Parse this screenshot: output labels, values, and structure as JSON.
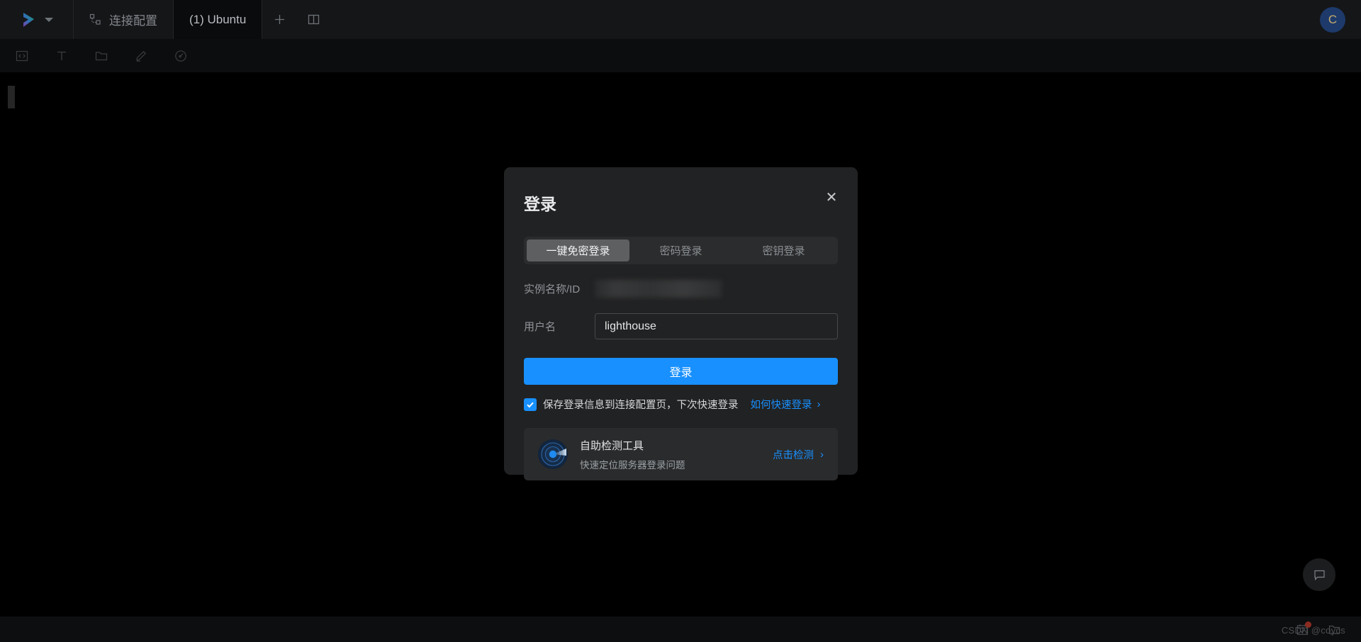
{
  "titlebar": {
    "logo_icon": "app-logo-chevron",
    "dropdown_icon": "chevron-down-icon",
    "tabs": [
      {
        "label": "连接配置",
        "icon": "topology-icon",
        "active": false
      },
      {
        "label": "(1) Ubuntu",
        "icon": "",
        "active": true
      }
    ],
    "new_tab_label": "+",
    "split_label": "split-pane-icon",
    "avatar_initial": "C"
  },
  "toolbar": {
    "items": [
      {
        "name": "code-icon"
      },
      {
        "name": "text-format-icon"
      },
      {
        "name": "folder-icon"
      },
      {
        "name": "edit-pencil-icon"
      },
      {
        "name": "speedometer-icon"
      }
    ]
  },
  "dialog": {
    "title": "登录",
    "close_label": "✕",
    "tabs": [
      {
        "label": "一键免密登录",
        "active": true
      },
      {
        "label": "密码登录",
        "active": false
      },
      {
        "label": "密钥登录",
        "active": false
      }
    ],
    "instance_field": {
      "label": "实例名称/ID",
      "value": "",
      "redacted": true
    },
    "username_field": {
      "label": "用户名",
      "value": "lighthouse",
      "placeholder": ""
    },
    "login_button": "登录",
    "save_checkbox": {
      "checked": true,
      "label": "保存登录信息到连接配置页，下次快速登录",
      "check_glyph": "✓"
    },
    "how_link": {
      "label": "如何快速登录",
      "chevron": "›"
    },
    "detect_card": {
      "icon": "radar-scan-icon",
      "title": "自助检测工具",
      "subtitle": "快速定位服务器登录问题",
      "link": "点击检测",
      "chevron": "›"
    }
  },
  "statusbar": {
    "calendar_icon": "calendar-check-icon",
    "has_badge": true,
    "folder_icon": "folder-icon"
  },
  "watermark": {
    "text": "CSDN @coycs"
  },
  "chat_fab": {
    "icon": "chat-bubble-icon"
  },
  "colors": {
    "accent": "#1890ff",
    "dialog_bg": "#212223",
    "titlebar_bg": "#151618",
    "terminal_bg": "#000000",
    "badge": "#8c2b22"
  }
}
